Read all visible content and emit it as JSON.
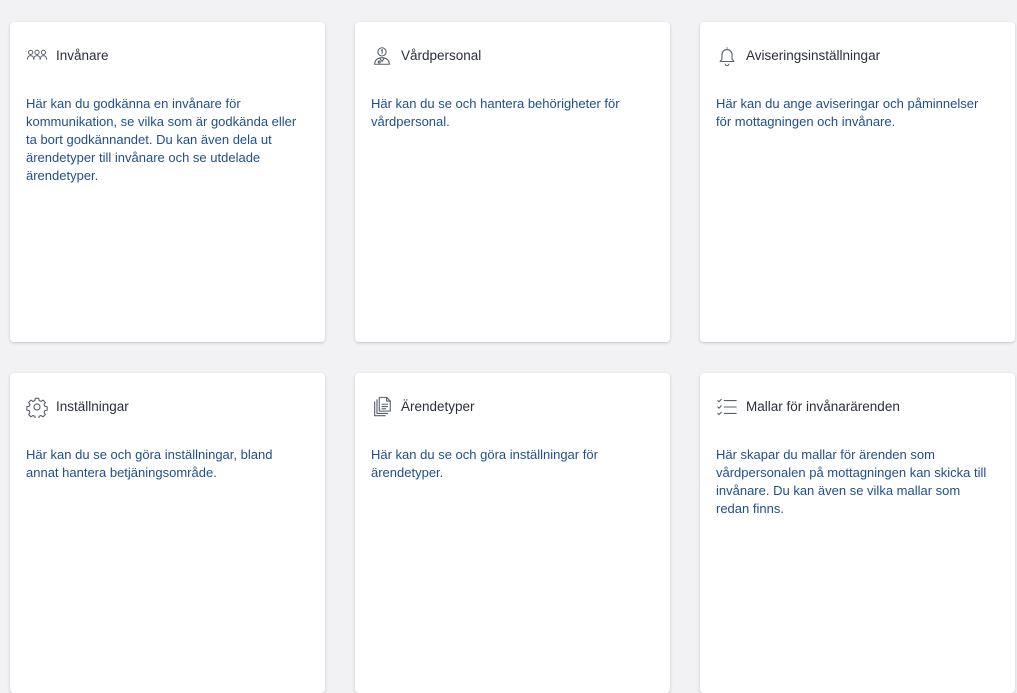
{
  "cards": [
    {
      "title": "Invånare",
      "icon": "group-icon",
      "description": "Här kan du godkänna en invånare för kommunikation, se vilka som är godkända eller ta bort godkännandet. Du kan även dela ut ärendetyper till invånare och se utdelade ärendetyper."
    },
    {
      "title": "Vårdpersonal",
      "icon": "caregiver-icon",
      "description": "Här kan du se och hantera behörigheter för vårdpersonal."
    },
    {
      "title": "Aviseringsinställningar",
      "icon": "bell-icon",
      "description": "Här kan du ange aviseringar och påminnelser för mottagningen och invånare."
    },
    {
      "title": "Inställningar",
      "icon": "gear-icon",
      "description": "Här kan du se och göra inställningar, bland annat hantera betjäningsområde."
    },
    {
      "title": "Ärendetyper",
      "icon": "documents-icon",
      "description": "Här kan du se och göra inställningar för ärendetyper."
    },
    {
      "title": "Mallar för invånarärenden",
      "icon": "checklist-icon",
      "description": "Här skapar du mallar för ärenden som vårdpersonalen på mottagningen kan skicka till invånare. Du kan även se vilka mallar som redan finns."
    }
  ],
  "colors": {
    "background": "#f2f2f5",
    "card": "#ffffff",
    "title_text": "#2b2f3a",
    "description_text": "#1f4f8a",
    "icon": "#5a5f6b"
  }
}
